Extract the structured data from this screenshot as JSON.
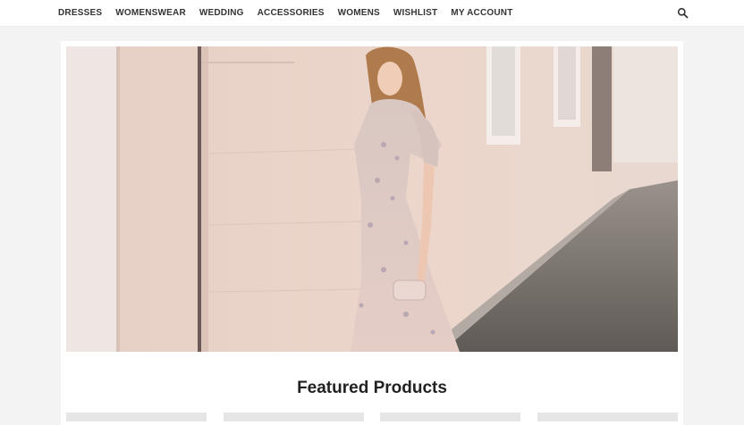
{
  "nav": {
    "items": [
      {
        "label": "DRESSES"
      },
      {
        "label": "WOMENSWEAR"
      },
      {
        "label": "WEDDING"
      },
      {
        "label": "ACCESSORIES"
      },
      {
        "label": "WOMENS"
      },
      {
        "label": "WISHLIST"
      },
      {
        "label": "MY ACCOUNT"
      }
    ],
    "search_icon": "search-icon"
  },
  "featured": {
    "title": "Featured Products"
  },
  "colors": {
    "nav_text": "#333333",
    "page_bg": "#f3f3f3",
    "title": "#222222"
  }
}
